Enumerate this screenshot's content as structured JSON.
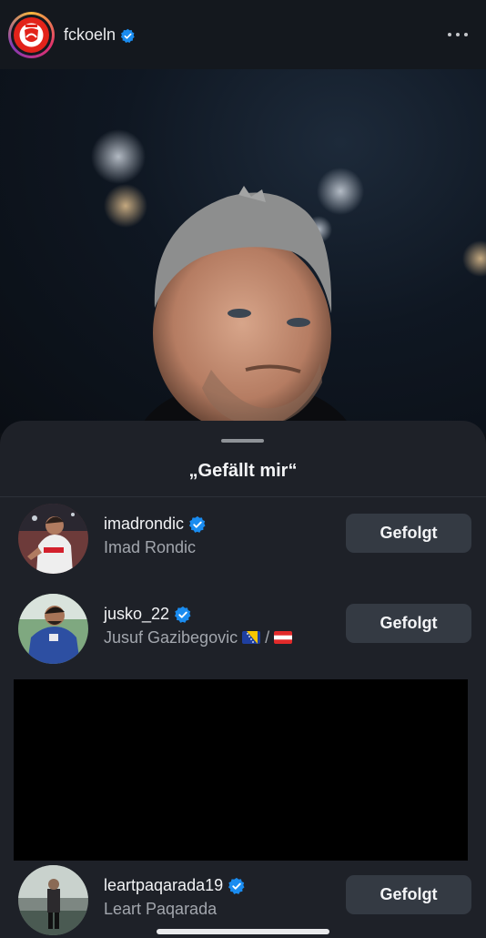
{
  "header": {
    "username": "fckoeln",
    "verified": true
  },
  "likes_sheet": {
    "title": "„Gefällt mir“",
    "rows": [
      {
        "handle": "imadrondic",
        "name": "Imad Rondic",
        "verified": true,
        "button": "Gefolgt"
      },
      {
        "handle": "jusko_22",
        "name": "Jusuf Gazibegovic",
        "name_suffix": "/",
        "verified": true,
        "button": "Gefolgt"
      },
      {
        "handle": "leartpaqarada19",
        "name": "Leart Paqarada",
        "verified": true,
        "button": "Gefolgt"
      }
    ]
  },
  "colors": {
    "background": "#0d1015",
    "sheet": "#1e2128",
    "button": "#343a43",
    "verified": "#1a8cf0"
  }
}
